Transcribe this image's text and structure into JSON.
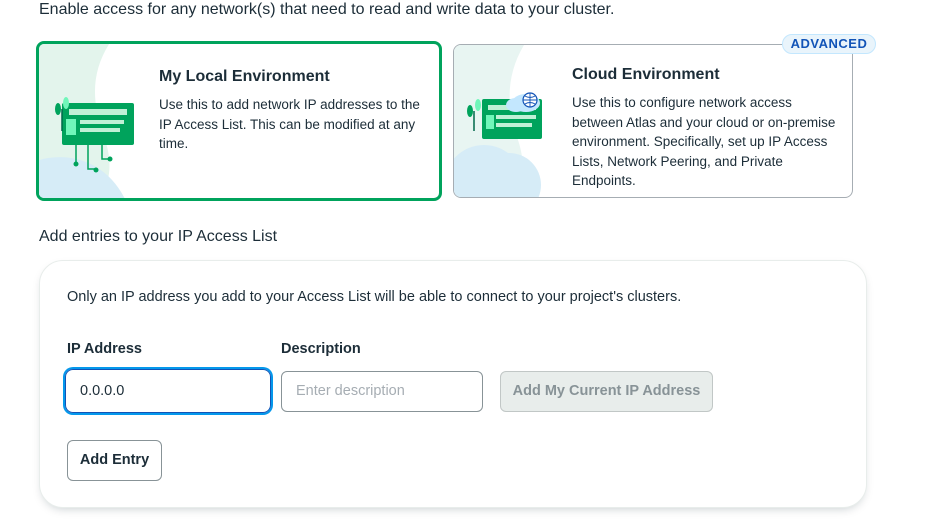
{
  "intro_text": "Enable access for any network(s) that need to read and write data to your cluster.",
  "environments": {
    "local": {
      "title": "My Local Environment",
      "description": "Use this to add network IP addresses to the IP Access List. This can be modified at any time.",
      "selected": true,
      "icon": "local-network-illustration"
    },
    "cloud": {
      "title": "Cloud Environment",
      "description": "Use this to configure network access between Atlas and your cloud or on-premise environment. Specifically, set up IP Access Lists, Network Peering, and Private Endpoints.",
      "badge": "ADVANCED",
      "icon": "cloud-network-illustration"
    }
  },
  "access_list": {
    "section_title": "Add entries to your IP Access List",
    "note": "Only an IP address you add to your Access List will be able to connect to your project's clusters.",
    "ip_label": "IP Address",
    "ip_value": "0.0.0.0",
    "description_label": "Description",
    "description_placeholder": "Enter description",
    "add_current_ip_label": "Add My Current IP Address",
    "add_entry_label": "Add Entry"
  },
  "colors": {
    "selected_border": "#00a35c",
    "focus_ring": "#0498ec",
    "badge_text": "#1254b7",
    "badge_bg": "#e9f4fb"
  }
}
